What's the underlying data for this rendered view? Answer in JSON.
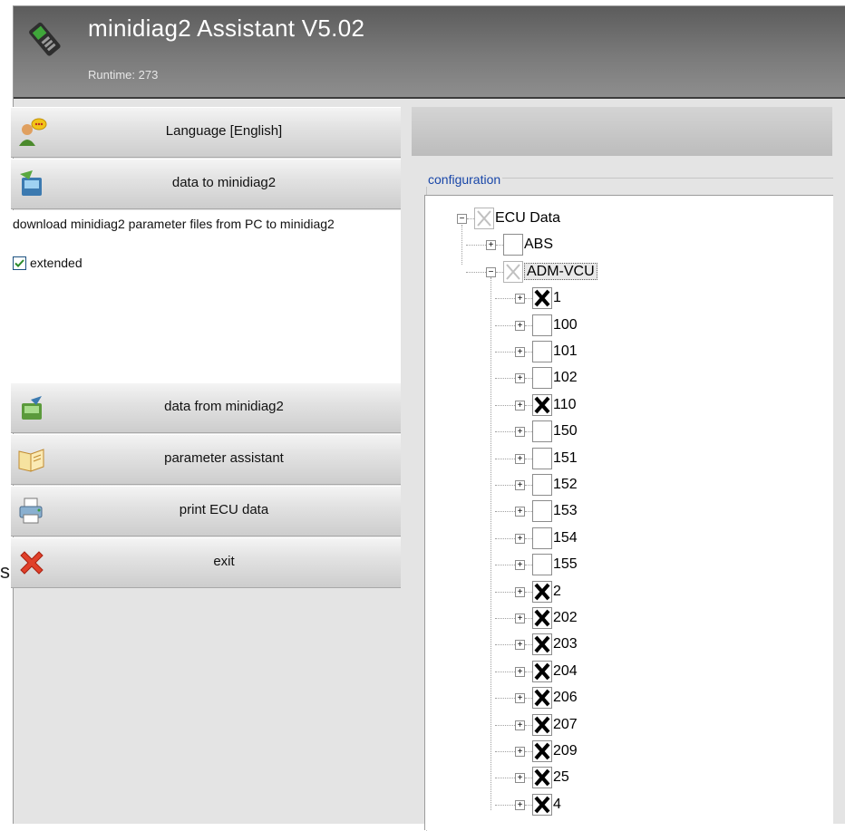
{
  "app": {
    "title": "minidiag2 Assistant V5.02",
    "runtime": "Runtime: 273"
  },
  "menu": {
    "language": "Language [English]",
    "data_to": "data to minidiag2",
    "data_to_desc": "download minidiag2 parameter files from PC to minidiag2",
    "extended_label": "extended",
    "extended_checked": true,
    "data_from": "data from minidiag2",
    "param_assistant": "parameter assistant",
    "print": "print ECU data",
    "exit": "exit"
  },
  "configuration": {
    "legend": "configuration",
    "root": "ECU Data",
    "groups": [
      {
        "label": "ABS",
        "expanded": false,
        "checked": false
      },
      {
        "label": "ADM-VCU",
        "expanded": true,
        "selected": true,
        "children": [
          {
            "label": "1",
            "checked": true
          },
          {
            "label": "100",
            "checked": false
          },
          {
            "label": "101",
            "checked": false
          },
          {
            "label": "102",
            "checked": false
          },
          {
            "label": "110",
            "checked": true
          },
          {
            "label": "150",
            "checked": false
          },
          {
            "label": "151",
            "checked": false
          },
          {
            "label": "152",
            "checked": false
          },
          {
            "label": "153",
            "checked": false
          },
          {
            "label": "154",
            "checked": false
          },
          {
            "label": "155",
            "checked": false
          },
          {
            "label": "2",
            "checked": true
          },
          {
            "label": "202",
            "checked": true
          },
          {
            "label": "203",
            "checked": true
          },
          {
            "label": "204",
            "checked": true
          },
          {
            "label": "206",
            "checked": true
          },
          {
            "label": "207",
            "checked": true
          },
          {
            "label": "209",
            "checked": true
          },
          {
            "label": "25",
            "checked": true
          },
          {
            "label": "4",
            "checked": true
          }
        ]
      }
    ]
  },
  "stray_text": "s"
}
